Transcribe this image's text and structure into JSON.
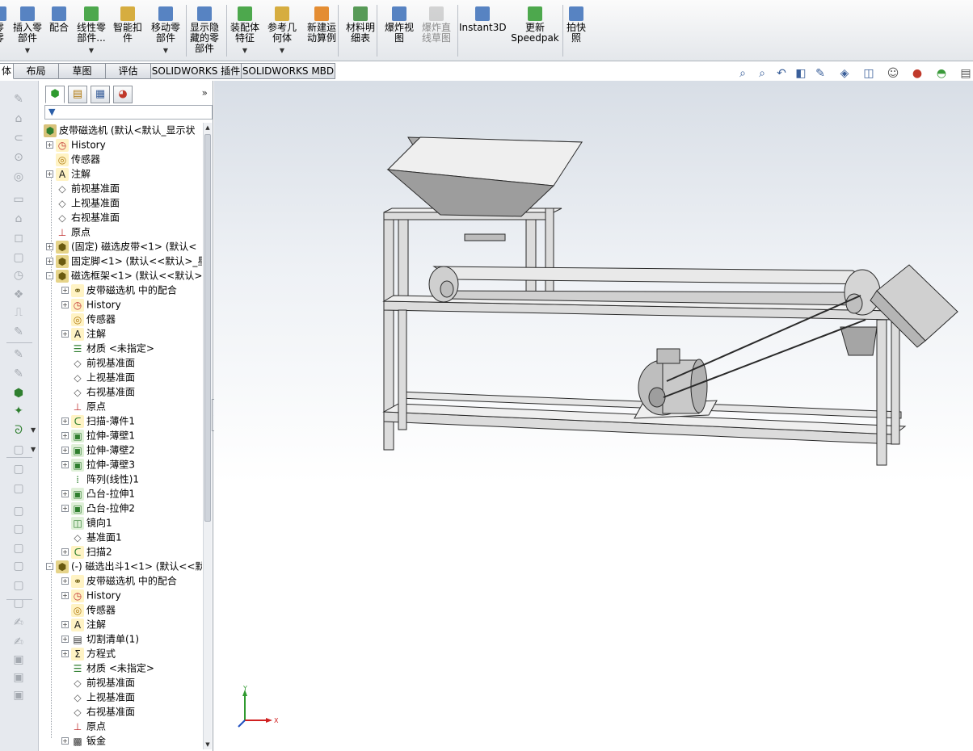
{
  "toolbar": {
    "buttons": [
      {
        "label": "零\n零",
        "icon": "insert-component-icon",
        "disabled": false
      },
      {
        "label": "插入零\n部件",
        "icon": "insert-component-icon",
        "disabled": false
      },
      {
        "label": "配合",
        "icon": "mate-icon",
        "disabled": false
      },
      {
        "label": "线性零\n部件...",
        "icon": "linear-pattern-icon",
        "disabled": false
      },
      {
        "label": "智能扣\n件",
        "icon": "smart-fastener-icon",
        "disabled": false
      },
      {
        "label": "移动零\n部件",
        "icon": "move-component-icon",
        "disabled": false
      },
      {
        "label": "显示隐\n藏的零\n部件",
        "icon": "show-hidden-icon",
        "disabled": false
      },
      {
        "label": "装配体\n特征",
        "icon": "assembly-feature-icon",
        "disabled": false
      },
      {
        "label": "参考几\n何体",
        "icon": "reference-geometry-icon",
        "disabled": false
      },
      {
        "label": "新建运\n动算例",
        "icon": "motion-study-icon",
        "disabled": false
      },
      {
        "label": "材料明\n细表",
        "icon": "bom-icon",
        "disabled": false
      },
      {
        "label": "爆炸视\n图",
        "icon": "exploded-view-icon",
        "disabled": false
      },
      {
        "label": "爆炸直\n线草图",
        "icon": "explode-line-icon",
        "disabled": true
      },
      {
        "label": "Instant3D",
        "icon": "instant3d-icon",
        "disabled": false
      },
      {
        "label": "更新\nSpeedpak",
        "icon": "speedpak-icon",
        "disabled": false
      },
      {
        "label": "拍快照",
        "icon": "snapshot-icon",
        "disabled": false
      }
    ]
  },
  "tabs": [
    "体",
    "布局",
    "草图",
    "评估",
    "SOLIDWORKS 插件",
    "SOLIDWORKS MBD"
  ],
  "view_icons": [
    "zoom-to-fit-icon",
    "zoom-area-icon",
    "previous-view-icon",
    "section-view-icon",
    "dynamic-annotation-icon",
    "view-orientation-icon",
    "display-style-icon",
    "hide-show-icon",
    "edit-appearance-icon",
    "scene-icon",
    "view-settings-icon"
  ],
  "panel": {
    "tabs": [
      "feature-manager-icon",
      "property-manager-icon",
      "configuration-manager-icon",
      "display-manager-icon"
    ],
    "more": "»",
    "filter": "▼"
  },
  "tree": [
    {
      "label": "皮带磁选机 (默认<默认_显示状",
      "level": 0,
      "icon": "assembly-icon",
      "exp": "none"
    },
    {
      "label": "History",
      "level": 1,
      "icon": "history-icon",
      "exp": "+"
    },
    {
      "label": "传感器",
      "level": 1,
      "icon": "sensor-icon",
      "exp": "none"
    },
    {
      "label": "注解",
      "level": 1,
      "icon": "annotation-icon",
      "exp": "+"
    },
    {
      "label": "前视基准面",
      "level": 1,
      "icon": "plane-icon",
      "exp": "none"
    },
    {
      "label": "上视基准面",
      "level": 1,
      "icon": "plane-icon",
      "exp": "none"
    },
    {
      "label": "右视基准面",
      "level": 1,
      "icon": "plane-icon",
      "exp": "none"
    },
    {
      "label": "原点",
      "level": 1,
      "icon": "origin-icon",
      "exp": "none"
    },
    {
      "label": "(固定) 磁选皮带<1> (默认<",
      "level": 1,
      "icon": "subassembly-icon",
      "exp": "+"
    },
    {
      "label": "固定脚<1> (默认<<默认>_星",
      "level": 1,
      "icon": "subassembly-icon",
      "exp": "+"
    },
    {
      "label": "磁选框架<1> (默认<<默认>",
      "level": 1,
      "icon": "subassembly-icon",
      "exp": "-"
    },
    {
      "label": "皮带磁选机 中的配合",
      "level": 2,
      "icon": "mates-icon",
      "exp": "+"
    },
    {
      "label": "History",
      "level": 2,
      "icon": "history-icon",
      "exp": "+"
    },
    {
      "label": "传感器",
      "level": 2,
      "icon": "sensor-icon",
      "exp": "none"
    },
    {
      "label": "注解",
      "level": 2,
      "icon": "annotation-icon",
      "exp": "+"
    },
    {
      "label": "材质 <未指定>",
      "level": 2,
      "icon": "material-icon",
      "exp": "none"
    },
    {
      "label": "前视基准面",
      "level": 2,
      "icon": "plane-icon",
      "exp": "none"
    },
    {
      "label": "上视基准面",
      "level": 2,
      "icon": "plane-icon",
      "exp": "none"
    },
    {
      "label": "右视基准面",
      "level": 2,
      "icon": "plane-icon",
      "exp": "none"
    },
    {
      "label": "原点",
      "level": 2,
      "icon": "origin-icon",
      "exp": "none"
    },
    {
      "label": "扫描-薄件1",
      "level": 2,
      "icon": "sweep-icon",
      "exp": "+"
    },
    {
      "label": "拉伸-薄壁1",
      "level": 2,
      "icon": "extrude-icon",
      "exp": "+"
    },
    {
      "label": "拉伸-薄壁2",
      "level": 2,
      "icon": "extrude-icon",
      "exp": "+"
    },
    {
      "label": "拉伸-薄壁3",
      "level": 2,
      "icon": "extrude-icon",
      "exp": "+"
    },
    {
      "label": "阵列(线性)1",
      "level": 2,
      "icon": "pattern-icon",
      "exp": "none"
    },
    {
      "label": "凸台-拉伸1",
      "level": 2,
      "icon": "extrude-icon",
      "exp": "+"
    },
    {
      "label": "凸台-拉伸2",
      "level": 2,
      "icon": "extrude-icon",
      "exp": "+"
    },
    {
      "label": "镜向1",
      "level": 2,
      "icon": "mirror-icon",
      "exp": "none"
    },
    {
      "label": "基准面1",
      "level": 2,
      "icon": "plane-icon",
      "exp": "none"
    },
    {
      "label": "扫描2",
      "level": 2,
      "icon": "sweep-icon",
      "exp": "+"
    },
    {
      "label": "(-) 磁选出斗1<1> (默认<<默",
      "level": 1,
      "icon": "subassembly-icon",
      "exp": "-"
    },
    {
      "label": "皮带磁选机 中的配合",
      "level": 2,
      "icon": "mates-icon",
      "exp": "+"
    },
    {
      "label": "History",
      "level": 2,
      "icon": "history-icon",
      "exp": "+"
    },
    {
      "label": "传感器",
      "level": 2,
      "icon": "sensor-icon",
      "exp": "none"
    },
    {
      "label": "注解",
      "level": 2,
      "icon": "annotation-icon",
      "exp": "+"
    },
    {
      "label": "切割清单(1)",
      "level": 2,
      "icon": "cutlist-icon",
      "exp": "+"
    },
    {
      "label": "方程式",
      "level": 2,
      "icon": "equation-icon",
      "exp": "+"
    },
    {
      "label": "材质 <未指定>",
      "level": 2,
      "icon": "material-icon",
      "exp": "none"
    },
    {
      "label": "前视基准面",
      "level": 2,
      "icon": "plane-icon",
      "exp": "none"
    },
    {
      "label": "上视基准面",
      "level": 2,
      "icon": "plane-icon",
      "exp": "none"
    },
    {
      "label": "右视基准面",
      "level": 2,
      "icon": "plane-icon",
      "exp": "none"
    },
    {
      "label": "原点",
      "level": 2,
      "icon": "origin-icon",
      "exp": "none"
    },
    {
      "label": "钣金",
      "level": 2,
      "icon": "sheetmetal-icon",
      "exp": "+"
    }
  ],
  "triad": {
    "y": "Y",
    "x": "X"
  },
  "colors": {
    "toolbar_bg": "#e8ebef",
    "active_icon": "#2f7f2f",
    "model_gray": "#d9d9d9",
    "hopper_gray": "#a9a9a9"
  }
}
